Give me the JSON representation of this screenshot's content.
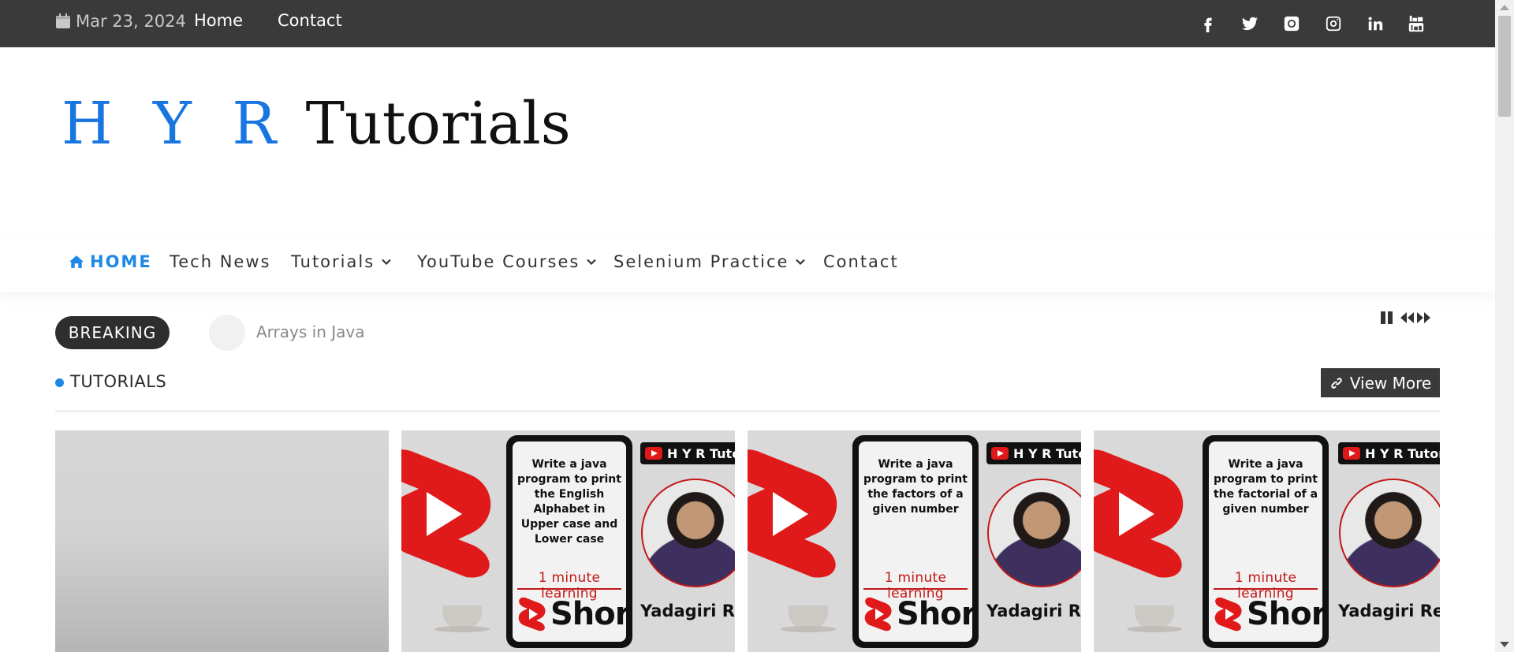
{
  "topbar": {
    "date": "Mar 23, 2024",
    "links": [
      "Home",
      "Contact"
    ],
    "social_icons": [
      "facebook-icon",
      "twitter-icon",
      "github-icon",
      "instagram-icon",
      "linkedin-icon",
      "youtube-icon"
    ]
  },
  "logo": {
    "part1": "H Y R",
    "part2": " Tutorials"
  },
  "nav": {
    "home": "HOME",
    "items": [
      "Tech News",
      "Tutorials",
      "YouTube Courses",
      "Selenium Practice",
      "Contact"
    ]
  },
  "breaking": {
    "label": "BREAKING",
    "headline": "Arrays in Java",
    "controls": [
      "pause-icon",
      "previous-icon",
      "next-icon"
    ]
  },
  "section": {
    "title": "TUTORIALS",
    "view_more": "View More"
  },
  "cards": [
    {
      "title_text": "",
      "placeholder": true
    },
    {
      "program": "Write a java program to print the English Alphabet in Upper case and Lower case",
      "tagline": "1 minute learning",
      "shorts": "Shorts",
      "channel": "H Y R Tutorials",
      "author": "Yadagiri Reddy"
    },
    {
      "program": "Write a java program to print the factors of a given number",
      "tagline": "1 minute learning",
      "shorts": "Shorts",
      "channel": "H Y R Tutorials",
      "author": "Yadagiri Reddy"
    },
    {
      "program": "Write a java program to print the factorial of a given number",
      "tagline": "1 minute learning",
      "shorts": "Shorts",
      "channel": "H Y R Tutorials",
      "author": "Yadagiri Reddy"
    }
  ],
  "colors": {
    "topbar_bg": "#3a3a3a",
    "accent": "#1e88e5",
    "shorts_red": "#c21818"
  }
}
